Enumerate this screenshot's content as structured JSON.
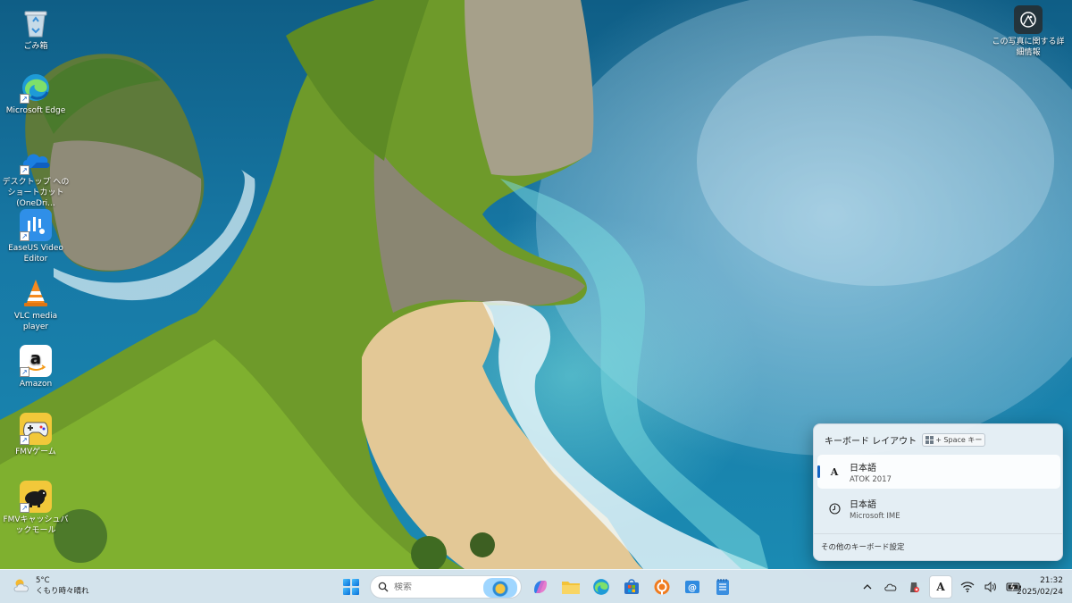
{
  "desktop": {
    "icons": [
      {
        "label": "ごみ箱",
        "icon": "recycle-bin-icon"
      },
      {
        "label": "Microsoft Edge",
        "icon": "edge-icon"
      },
      {
        "label": "デスクトップ へのショートカット (OneDri...",
        "icon": "onedrive-icon"
      },
      {
        "label": "EaseUS Video Editor",
        "icon": "easeus-icon"
      },
      {
        "label": "VLC media player",
        "icon": "vlc-icon"
      },
      {
        "label": "Amazon",
        "icon": "amazon-icon"
      },
      {
        "label": "FMVゲーム",
        "icon": "gamepad-icon"
      },
      {
        "label": "FMVキャッシュバックモール",
        "icon": "cashback-icon"
      }
    ],
    "photo_info": {
      "label": "この写真に関する詳細情報",
      "icon": "photo-info-icon"
    }
  },
  "keyboard_flyout": {
    "title": "キーボード レイアウト",
    "hint_suffix": "+ Space キー",
    "items": [
      {
        "language": "日本語",
        "ime": "ATOK 2017",
        "icon_glyph": "A",
        "selected": true
      },
      {
        "language": "日本語",
        "ime": "Microsoft IME",
        "icon_glyph": "あ",
        "selected": false
      }
    ],
    "more_settings": "その他のキーボード設定"
  },
  "taskbar": {
    "weather": {
      "temp": "5°C",
      "condition": "くもり時々晴れ"
    },
    "search": {
      "placeholder": "検索"
    },
    "apps": [
      "copilot-icon",
      "file-explorer-icon",
      "edge-icon",
      "store-icon",
      "app-icon",
      "mail-icon",
      "notepad-icon"
    ],
    "tray": {
      "ime_glyph": "A"
    },
    "clock": {
      "time": "21:32",
      "date": "2025/02/24"
    }
  },
  "colors": {
    "accent": "#1463c2",
    "taskbar": "#dce8f0",
    "flyout": "#ecf3f7"
  }
}
